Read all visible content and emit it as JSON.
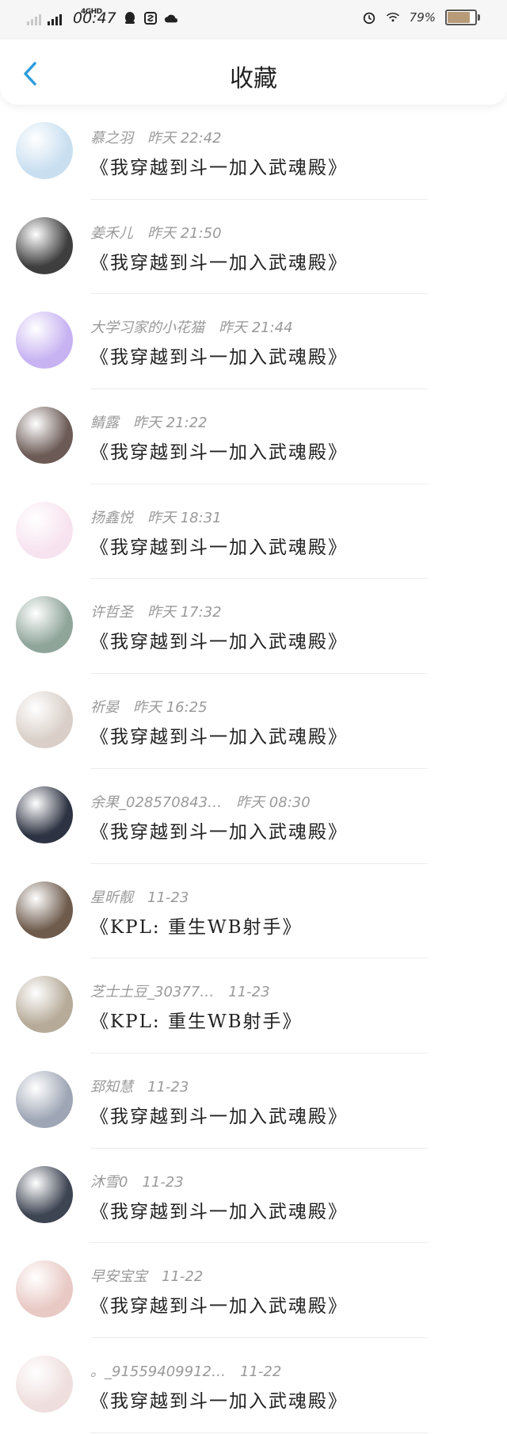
{
  "status_bar": {
    "network": "4GHD",
    "time": "00:47",
    "battery_percent": "79%",
    "battery_level": 0.79,
    "icons": [
      "qq-icon",
      "soul-icon",
      "cloud-icon",
      "alarm-icon",
      "wifi-icon"
    ]
  },
  "header": {
    "title": "收藏",
    "back_icon": "chevron-left-icon",
    "accent_color": "#2d9cdb"
  },
  "favorites": [
    {
      "user": "慕之羽",
      "time": "昨天 22:42",
      "book": "《我穿越到斗一加入武魂殿》",
      "avatar_color": "#c9dff0"
    },
    {
      "user": "姜禾儿",
      "time": "昨天 21:50",
      "book": "《我穿越到斗一加入武魂殿》",
      "avatar_color": "#3e3e3e"
    },
    {
      "user": "大学习家的小花猫",
      "time": "昨天 21:44",
      "book": "《我穿越到斗一加入武魂殿》",
      "avatar_color": "#c7b2f2"
    },
    {
      "user": "鲭露",
      "time": "昨天 21:22",
      "book": "《我穿越到斗一加入武魂殿》",
      "avatar_color": "#6b5a55"
    },
    {
      "user": "扬鑫悦",
      "time": "昨天 18:31",
      "book": "《我穿越到斗一加入武魂殿》",
      "avatar_color": "#f7e3ef"
    },
    {
      "user": "许哲圣",
      "time": "昨天 17:32",
      "book": "《我穿越到斗一加入武魂殿》",
      "avatar_color": "#8fa59a"
    },
    {
      "user": "祈晏",
      "time": "昨天 16:25",
      "book": "《我穿越到斗一加入武魂殿》",
      "avatar_color": "#d9cfc8"
    },
    {
      "user": "余果_028570843…",
      "time": "昨天 08:30",
      "book": "《我穿越到斗一加入武魂殿》",
      "avatar_color": "#2d3342"
    },
    {
      "user": "星昕靓",
      "time": "11-23",
      "book": "《KPL: 重生WB射手》",
      "avatar_color": "#6e5b4c"
    },
    {
      "user": "芝士土豆_30377…",
      "time": "11-23",
      "book": "《KPL: 重生WB射手》",
      "avatar_color": "#b6aa98"
    },
    {
      "user": "郅知慧",
      "time": "11-23",
      "book": "《我穿越到斗一加入武魂殿》",
      "avatar_color": "#9ea6b5"
    },
    {
      "user": "沐雪0",
      "time": "11-23",
      "book": "《我穿越到斗一加入武魂殿》",
      "avatar_color": "#3d4452"
    },
    {
      "user": "早安宝宝",
      "time": "11-22",
      "book": "《我穿越到斗一加入武魂殿》",
      "avatar_color": "#e8c9c4"
    },
    {
      "user": "。_91559409912…",
      "time": "11-22",
      "book": "《我穿越到斗一加入武魂殿》",
      "avatar_color": "#efdede"
    }
  ]
}
